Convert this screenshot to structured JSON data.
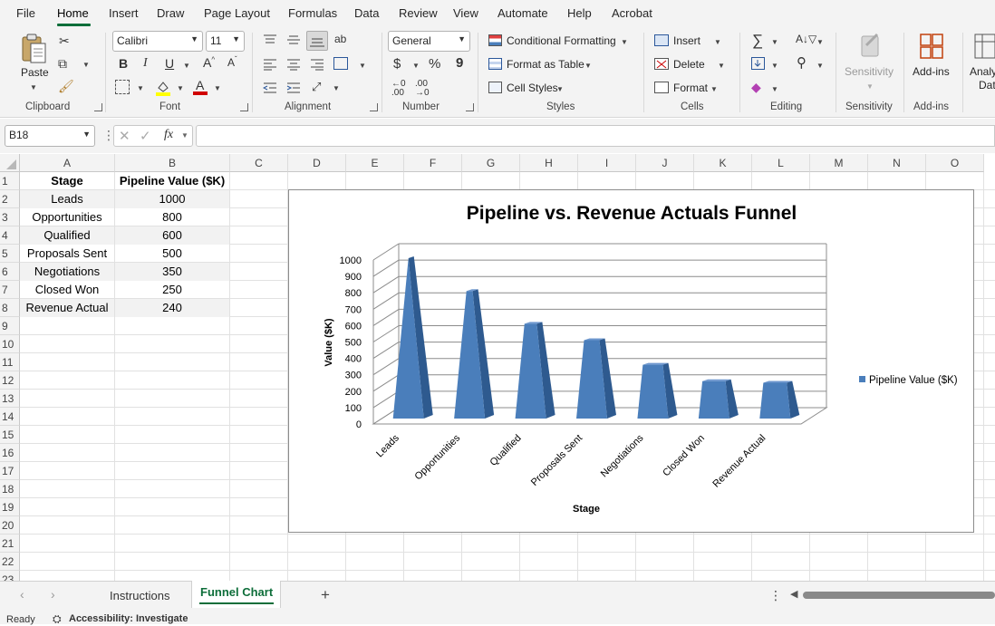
{
  "menu": {
    "items": [
      "File",
      "Home",
      "Insert",
      "Draw",
      "Page Layout",
      "Formulas",
      "Data",
      "Review",
      "View",
      "Automate",
      "Help",
      "Acrobat"
    ],
    "active": "Home"
  },
  "ribbon": {
    "clipboard": {
      "paste_label": "Paste",
      "group_label": "Clipboard"
    },
    "font": {
      "font_name": "Calibri",
      "font_size": "11",
      "group_label": "Font",
      "bold": "B",
      "italic": "I",
      "underline": "U"
    },
    "alignment": {
      "group_label": "Alignment"
    },
    "number": {
      "format": "General",
      "currency": "$",
      "percent": "%",
      "comma": "9",
      "group_label": "Number"
    },
    "styles": {
      "conditional_formatting": "Conditional Formatting",
      "format_as_table": "Format as Table",
      "cell_styles": "Cell Styles",
      "group_label": "Styles"
    },
    "cells": {
      "insert": "Insert",
      "delete": "Delete",
      "format": "Format",
      "group_label": "Cells"
    },
    "editing": {
      "group_label": "Editing"
    },
    "sensitivity": {
      "label": "Sensitivity",
      "group_label": "Sensitivity"
    },
    "addins": {
      "label": "Add-ins",
      "group_label": "Add-ins"
    },
    "analyze": {
      "label": "Analy",
      "label2": "Dat"
    }
  },
  "formula_bar": {
    "name_box": "B18",
    "fx": "fx",
    "value": ""
  },
  "columns": [
    "A",
    "B",
    "C",
    "D",
    "E",
    "F",
    "G",
    "H",
    "I",
    "J",
    "K",
    "L",
    "M",
    "N",
    "O"
  ],
  "rows": [
    "1",
    "2",
    "3",
    "4",
    "5",
    "6",
    "7",
    "8",
    "9",
    "10",
    "11",
    "12",
    "13",
    "14",
    "15",
    "16",
    "17",
    "18",
    "19",
    "20",
    "21",
    "22",
    "23"
  ],
  "table": {
    "headers": [
      "Stage",
      "Pipeline Value ($K)"
    ],
    "rows": [
      [
        "Leads",
        "1000"
      ],
      [
        "Opportunities",
        "800"
      ],
      [
        "Qualified",
        "600"
      ],
      [
        "Proposals Sent",
        "500"
      ],
      [
        "Negotiations",
        "350"
      ],
      [
        "Closed Won",
        "250"
      ],
      [
        "Revenue Actual",
        "240"
      ]
    ]
  },
  "chart_data": {
    "type": "bar",
    "title": "Pipeline vs. Revenue Actuals Funnel",
    "xlabel": "Stage",
    "ylabel": "Value ($K)",
    "categories": [
      "Leads",
      "Opportunities",
      "Qualified",
      "Proposals Sent",
      "Negotiations",
      "Closed Won",
      "Revenue Actual"
    ],
    "series": [
      {
        "name": "Pipeline Value ($K)",
        "values": [
          1000,
          800,
          600,
          500,
          350,
          250,
          240
        ],
        "color": "#4a7ebb"
      }
    ],
    "ylim": [
      0,
      1000
    ],
    "yticks": [
      "0",
      "100",
      "200",
      "300",
      "400",
      "500",
      "600",
      "700",
      "800",
      "900",
      "1000"
    ],
    "grid": true,
    "legend": "right",
    "style": "3d-pyramid"
  },
  "sheets": {
    "tabs": [
      "Instructions",
      "Funnel Chart"
    ],
    "active": "Funnel Chart",
    "add": "+"
  },
  "status": {
    "ready": "Ready",
    "accessibility": "Accessibility: Investigate"
  }
}
